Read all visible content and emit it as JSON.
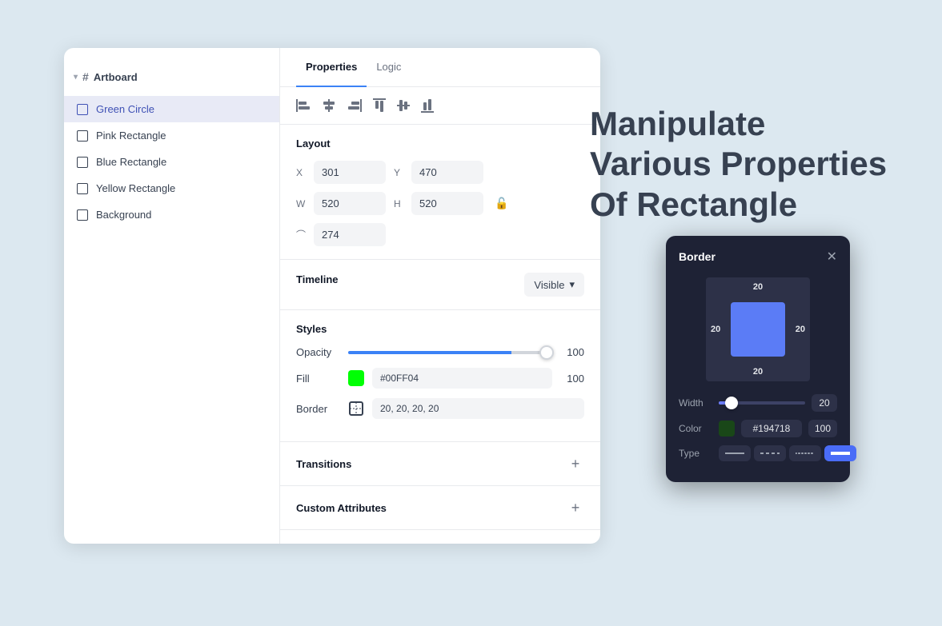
{
  "heading": {
    "line1": "Manipulate",
    "line2": "Various Properties",
    "line3": "Of Rectangle"
  },
  "panel": {
    "tabs": [
      {
        "label": "Properties",
        "active": true
      },
      {
        "label": "Logic",
        "active": false
      }
    ]
  },
  "sidebar": {
    "artboard_label": "Artboard",
    "items": [
      {
        "label": "Green Circle",
        "active": true
      },
      {
        "label": "Pink Rectangle",
        "active": false
      },
      {
        "label": "Blue Rectangle",
        "active": false
      },
      {
        "label": "Yellow Rectangle",
        "active": false
      },
      {
        "label": "Background",
        "active": false
      }
    ]
  },
  "alignment": {
    "buttons": [
      "align-left",
      "align-center-h",
      "align-right",
      "align-top",
      "align-center-v",
      "align-bottom"
    ]
  },
  "layout": {
    "x_label": "X",
    "y_label": "Y",
    "w_label": "W",
    "h_label": "H",
    "x_value": "301",
    "y_value": "470",
    "w_value": "520",
    "h_value": "520",
    "radius_value": "274"
  },
  "timeline": {
    "label": "Timeline",
    "visibility": "Visible"
  },
  "styles": {
    "label": "Styles",
    "opacity": {
      "label": "Opacity",
      "value": "100"
    },
    "fill": {
      "label": "Fill",
      "color": "#00FF04",
      "hex": "#00FF04",
      "opacity": "100"
    },
    "border": {
      "label": "Border",
      "value": "20, 20, 20, 20",
      "opacity": ""
    }
  },
  "transitions_label": "Transitions",
  "custom_attributes_label": "Custom Attributes",
  "border_popup": {
    "title": "Border",
    "numbers": {
      "top": "20",
      "bottom": "20",
      "left": "20",
      "right": "20"
    },
    "width": {
      "label": "Width",
      "value": "20"
    },
    "color": {
      "label": "Color",
      "swatch": "#194718",
      "hex": "#194718",
      "opacity": "100"
    },
    "type": {
      "label": "Type",
      "options": [
        "solid-light",
        "dashed",
        "dotted",
        "solid-bold"
      ]
    }
  }
}
